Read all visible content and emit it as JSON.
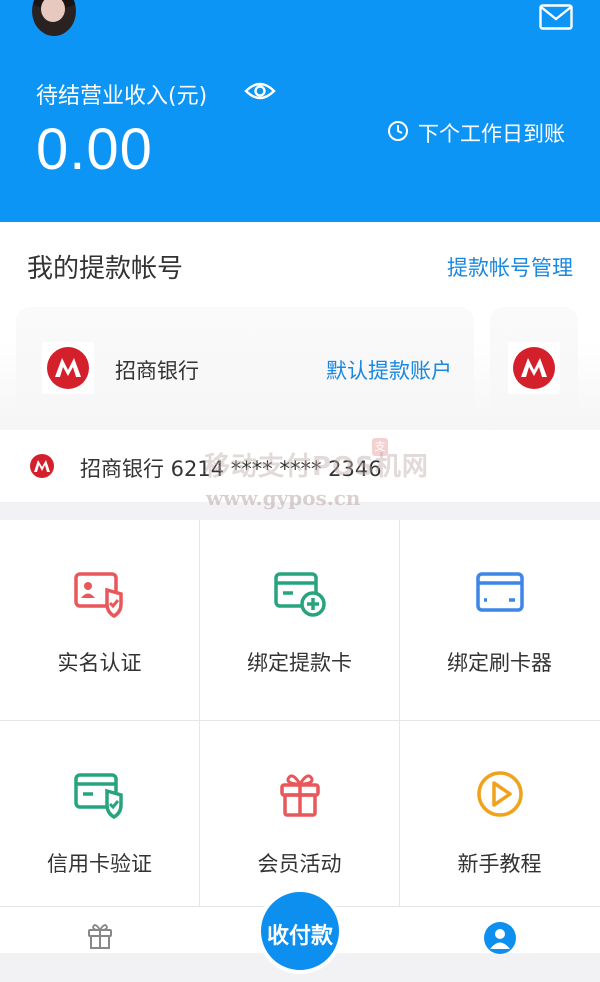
{
  "header": {
    "income_label": "待结营业收入(元)",
    "amount": "0.00",
    "settle_text": "下个工作日到账"
  },
  "accounts": {
    "title": "我的提款帐号",
    "manage_link": "提款帐号管理",
    "card": {
      "bank_name": "招商银行",
      "default_label": "默认提款账户"
    },
    "selected_account": "招商银行 6214 **** **** 2346"
  },
  "watermark": {
    "line1": "移动支付POS机网",
    "line2": "www.gypos.cn",
    "seal": "支"
  },
  "grid": {
    "items": [
      {
        "label": "实名认证",
        "icon": "id-card-shield-icon",
        "color": "#e8575a"
      },
      {
        "label": "绑定提款卡",
        "icon": "card-add-icon",
        "color": "#27a47e"
      },
      {
        "label": "绑定刷卡器",
        "icon": "card-reader-icon",
        "color": "#3b86e6"
      },
      {
        "label": "信用卡验证",
        "icon": "card-verify-icon",
        "color": "#27a47e"
      },
      {
        "label": "会员活动",
        "icon": "gift-icon",
        "color": "#e8575a"
      },
      {
        "label": "新手教程",
        "icon": "play-circle-icon",
        "color": "#f0a21c"
      }
    ]
  },
  "tabbar": {
    "pay_label": "收付款"
  },
  "colors": {
    "primary": "#0d95f5",
    "link": "#1a88e0",
    "bank_red": "#d4202b"
  }
}
